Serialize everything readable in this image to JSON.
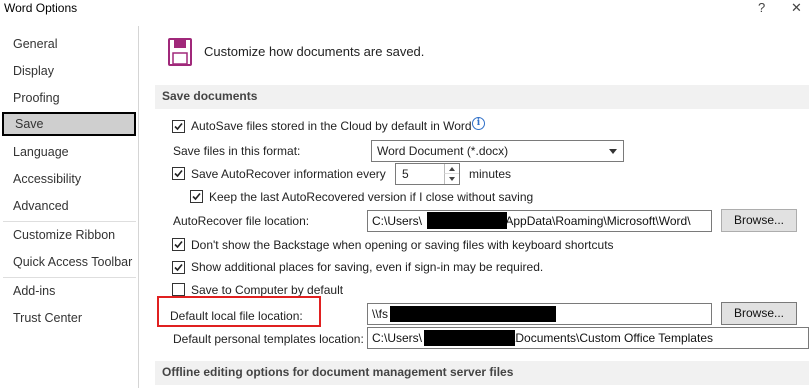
{
  "window": {
    "title": "Word Options",
    "help_glyph": "?",
    "close_glyph": "✕"
  },
  "sidebar": {
    "items": [
      {
        "label": "General"
      },
      {
        "label": "Display"
      },
      {
        "label": "Proofing"
      },
      {
        "label": "Save",
        "selected": true
      },
      {
        "label": "Language"
      },
      {
        "label": "Accessibility"
      },
      {
        "label": "Advanced"
      },
      {
        "label": "Customize Ribbon"
      },
      {
        "label": "Quick Access Toolbar"
      },
      {
        "label": "Add-ins"
      },
      {
        "label": "Trust Center"
      }
    ]
  },
  "header": {
    "text": "Customize how documents are saved.",
    "icon": "save-floppy-icon"
  },
  "save_documents": {
    "section_title": "Save documents",
    "autosave_cloud": {
      "label": "AutoSave files stored in the Cloud by default in Word",
      "checked": true,
      "info_glyph": "i"
    },
    "format": {
      "label": "Save files in this format:",
      "value": "Word Document (*.docx)"
    },
    "autorecover": {
      "label": "Save AutoRecover information every",
      "checked": true,
      "value": "5",
      "unit": "minutes"
    },
    "keep_last": {
      "label": "Keep the last AutoRecovered version if I close without saving",
      "checked": true
    },
    "autorecover_location": {
      "label": "AutoRecover file location:",
      "prefix": "C:\\Users\\",
      "suffix": "\\AppData\\Roaming\\Microsoft\\Word\\",
      "button": "Browse..."
    },
    "backstage": {
      "label": "Don't show the Backstage when opening or saving files with keyboard shortcuts",
      "checked": true
    },
    "additional_places": {
      "label": "Show additional places for saving, even if sign-in may be required.",
      "checked": true
    },
    "save_to_computer": {
      "label": "Save to Computer by default",
      "checked": false
    },
    "default_local": {
      "label": "Default local file location:",
      "prefix": "\\\\fs",
      "button": "Browse..."
    },
    "templates_location": {
      "label": "Default personal templates location:",
      "prefix": "C:\\Users\\",
      "suffix": "\\Documents\\Custom Office Templates"
    }
  },
  "offline": {
    "section_title": "Offline editing options for document management server files"
  },
  "colors": {
    "accent_red": "#e02020",
    "floppy": "#a0287a",
    "selected_bg": "#cfcfcf"
  }
}
